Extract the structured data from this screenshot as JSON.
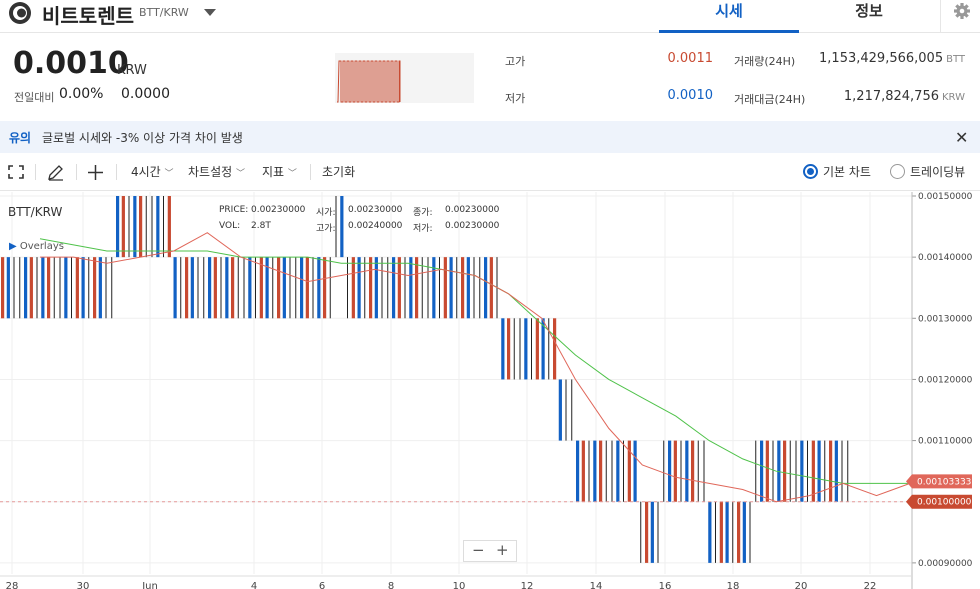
{
  "header": {
    "coin_name": "비트토렌트",
    "pair": "BTT/KRW",
    "tabs": [
      "시세",
      "정보"
    ]
  },
  "price": {
    "current": "0.0010",
    "currency": "KRW",
    "change_label": "전일대비",
    "change_pct": "0.00%",
    "change_val": "0.0000"
  },
  "stats": {
    "high_label": "고가",
    "high": "0.0011",
    "low_label": "저가",
    "low": "0.0010",
    "volume_label": "거래량(24H)",
    "volume": "1,153,429,566,005",
    "volume_unit": "BTT",
    "amount_label": "거래대금(24H)",
    "amount": "1,217,824,756",
    "amount_unit": "KRW"
  },
  "notice": {
    "tag": "유의",
    "text": "글로벌 시세와 -3% 이상 가격 차이 발생"
  },
  "toolbar": {
    "interval": "4시간",
    "chart_settings": "차트설정",
    "indicators": "지표",
    "reset": "초기화",
    "basic_chart": "기본 차트",
    "tradingview": "트레이딩뷰"
  },
  "chart_legend": {
    "symbol": "BTT/KRW",
    "overlays": "Overlays",
    "price_label": "PRICE:",
    "price": "0.00230000",
    "vol_label": "VOL:",
    "vol": "2.8T",
    "open_label": "시가:",
    "open": "0.00230000",
    "high_label": "고가:",
    "high": "0.00240000",
    "close_label": "종가:",
    "close": "0.00230000",
    "low_label": "저가:",
    "low": "0.00230000"
  },
  "colors": {
    "up": "#c84a31",
    "down": "#1261c4",
    "ma_short": "#e0675a",
    "ma_long": "#4fc24a",
    "accent": "#1261c4"
  },
  "chart_data": {
    "type": "candlestick",
    "x_tick_labels": [
      "28",
      "30",
      "Jun",
      "4",
      "6",
      "8",
      "10",
      "12",
      "14",
      "16",
      "18",
      "20",
      "22"
    ],
    "y_tick_labels": [
      "0.00150000",
      "0.00140000",
      "0.00130000",
      "0.00120000",
      "0.00110000",
      "0.00100000",
      "0.00090000"
    ],
    "ylim": [
      0.00089,
      0.0015
    ],
    "current_price_tag": "0.00100000",
    "ma_tag": "0.00103333",
    "segments": [
      {
        "n": 20,
        "lo": 0.0013,
        "hi": 0.0014
      },
      {
        "n": 10,
        "lo": 0.0014,
        "hi": 0.0015
      },
      {
        "n": 28,
        "lo": 0.0013,
        "hi": 0.0014
      },
      {
        "n": 2,
        "lo": 0.0014,
        "hi": 0.0015
      },
      {
        "n": 27,
        "lo": 0.0013,
        "hi": 0.0014
      },
      {
        "n": 10,
        "lo": 0.0012,
        "hi": 0.0013
      },
      {
        "n": 3,
        "lo": 0.0011,
        "hi": 0.0012
      },
      {
        "n": 11,
        "lo": 0.001,
        "hi": 0.0011
      },
      {
        "n": 4,
        "lo": 0.0009,
        "hi": 0.001
      },
      {
        "n": 8,
        "lo": 0.001,
        "hi": 0.0011
      },
      {
        "n": 8,
        "lo": 0.0009,
        "hi": 0.001
      },
      {
        "n": 17,
        "lo": 0.001,
        "hi": 0.0011
      }
    ],
    "ma_short": [
      0.0014,
      0.0014,
      0.00139,
      0.0014,
      0.00141,
      0.00144,
      0.0014,
      0.00138,
      0.00136,
      0.00137,
      0.00138,
      0.00137,
      0.00138,
      0.00137,
      0.00134,
      0.0013,
      0.0012,
      0.00112,
      0.00106,
      0.00104,
      0.00103,
      0.00102,
      0.001,
      0.00101,
      0.00103,
      0.00101,
      0.00103
    ],
    "ma_long": [
      0.00143,
      0.00142,
      0.00141,
      0.00141,
      0.00141,
      0.00141,
      0.0014,
      0.0014,
      0.0014,
      0.00139,
      0.00139,
      0.00139,
      0.00138,
      0.00137,
      0.00134,
      0.00129,
      0.00124,
      0.0012,
      0.00117,
      0.00114,
      0.0011,
      0.00107,
      0.00105,
      0.00104,
      0.00103,
      0.00103,
      0.00103
    ]
  }
}
